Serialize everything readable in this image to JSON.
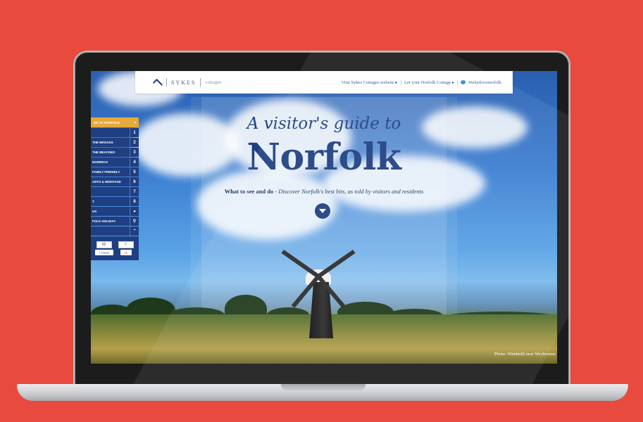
{
  "header": {
    "logo_text": "SYKES",
    "logo_sub": "cottages",
    "links": [
      "Visit Sykes Cottages website ▸",
      "Let your Norfolk Cottage ▸",
      "#whyilovenorfolk"
    ]
  },
  "hero": {
    "subtitle": "A visitor's guide to",
    "title": "Norfolk",
    "tagline_bold": "What to see and do",
    "tagline_sep": " - ",
    "tagline_italic": "Discover Norfolk's best bits, as told by visitors and residents",
    "photo_credit": "Photo: Windmill near Weybourne"
  },
  "sidebar": {
    "head_label": "DE TO NORFOLK",
    "head_icon": "up-caret",
    "items": [
      {
        "label": "",
        "num": "1"
      },
      {
        "label": "THE BROADS",
        "num": "2"
      },
      {
        "label": "THE BEACHES",
        "num": "3"
      },
      {
        "label": "NORWICH",
        "num": "4"
      },
      {
        "label": "FAMILY FRIENDLY",
        "num": "5"
      },
      {
        "label": "ARTS & HERITAGE",
        "num": "6"
      },
      {
        "label": "",
        "num": "7"
      },
      {
        "label": "T",
        "num": "8"
      },
      {
        "label": "US",
        "num": "chat-icon"
      },
      {
        "label": "FOLK HOLIDAY",
        "num": "pin-icon"
      },
      {
        "label": "",
        "num": "up-icon"
      }
    ],
    "social": {
      "count_left": "52",
      "count_right": "7",
      "tweet_label": "Tweet",
      "gplus_label": "+1"
    }
  },
  "colors": {
    "background": "#e84a3d",
    "brand_blue": "#1f3f82",
    "accent_orange": "#e6a93a"
  }
}
